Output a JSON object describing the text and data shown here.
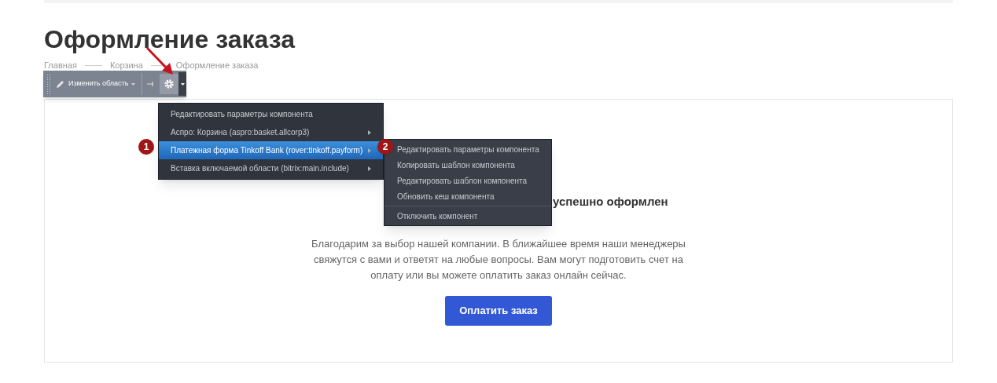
{
  "page_title": "Оформление заказа",
  "breadcrumbs": [
    "Главная",
    "Корзина",
    "Оформление заказа"
  ],
  "toolbar": {
    "edit_area": "Изменить область"
  },
  "menu": [
    {
      "label": "Редактировать параметры компонента",
      "has_submenu": false,
      "selected": false
    },
    {
      "label": "Аспро: Корзина (aspro:basket.allcorp3)",
      "has_submenu": true,
      "selected": false
    },
    {
      "label": "Платежная форма Tinkoff Bank (rover:tinkoff.payform)",
      "has_submenu": true,
      "selected": true,
      "step": "1"
    },
    {
      "label": "Вставка включаемой области (bitrix:main.include)",
      "has_submenu": true,
      "selected": false
    }
  ],
  "submenu": {
    "step": "2",
    "items": [
      {
        "label": "Редактировать параметры компонента",
        "divider_before": false
      },
      {
        "label": "Копировать шаблон компонента",
        "divider_before": false
      },
      {
        "label": "Редактировать шаблон компонента",
        "divider_before": false
      },
      {
        "label": "Обновить кеш компонента",
        "divider_before": false
      },
      {
        "label": "Отключить компонент",
        "divider_before": true
      }
    ]
  },
  "order": {
    "heading": "успешно оформлен",
    "message": "Благодарим за выбор нашей компании. В ближайшее время наши менеджеры свяжутся с вами и ответят на любые вопросы. Вам могут подготовить счет на оплату или вы можете оплатить заказ онлайн сейчас.",
    "pay_button": "Оплатить заказ"
  }
}
